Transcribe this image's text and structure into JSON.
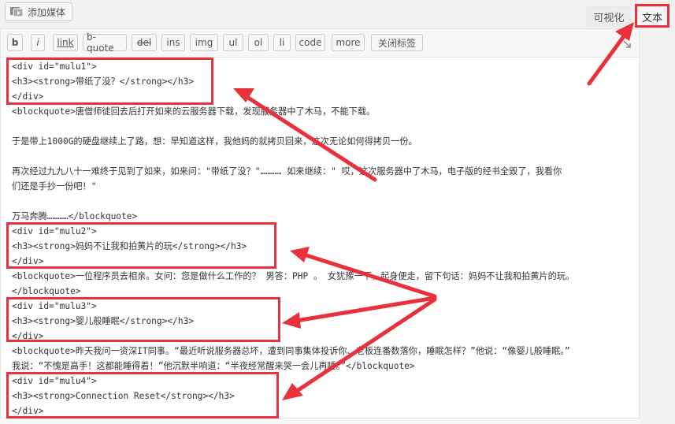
{
  "top": {
    "add_media": "添加媒体",
    "tab_visual": "可视化",
    "tab_text": "文本"
  },
  "toolbar": {
    "buttons": [
      "b",
      "i",
      "link",
      "b-quote",
      "del",
      "ins",
      "img",
      "ul",
      "ol",
      "li",
      "code",
      "more",
      "关闭标签"
    ]
  },
  "content": {
    "lines": [
      "<div id=\"mulu1\">",
      "<h3><strong>带纸了没？</strong></h3>",
      "</div>",
      "<blockquote>唐僧师徒回去后打开如来的云服务器下载，发现服务器中了木马，不能下载。",
      "",
      "于是带上1000G的硬盘继续上了路，想：早知道这样，我他妈的就拷贝回来，这次无论如何得拷贝一份。",
      "",
      "再次经过九九八十一难终于见到了如来，如来问：\"带纸了没？\"…………  如来继续：\" 哎，这次服务器中了木马，电子版的经书全毁了，我看你",
      "们还是手抄一份吧！\"",
      "",
      "万马奔腾…………</blockquote>",
      "<div id=\"mulu2\">",
      "<h3><strong>妈妈不让我和拍黄片的玩</strong></h3>",
      "</div>",
      "<blockquote>一位程序员去相亲。女问：您是做什么工作的？ 男答：PHP 。 女犹豫一下，起身便走，留下句话：妈妈不让我和拍黄片的玩。",
      "</blockquote>",
      "<div id=\"mulu3\">",
      "<h3><strong>婴儿般睡眠</strong></h3>",
      "</div>",
      "<blockquote>昨天我问一资深IT同事。“最近听说服务器总坏，遭到同事集体投诉你、老板连番数落你，睡眠怎样？”他说：“像婴儿般睡眠。”",
      "我说：“不愧是高手！这都能睡得着！”他沉默半响道：“半夜经常醒来哭一会儿再睡。”</blockquote>",
      "<div id=\"mulu4\">",
      "<h3><strong>Connection Reset</strong></h3>",
      "</div>"
    ]
  },
  "colors": {
    "annotation": "#e8313a",
    "editor_bg": "#ffffff",
    "toolbar_bg": "#f7f7f7"
  }
}
